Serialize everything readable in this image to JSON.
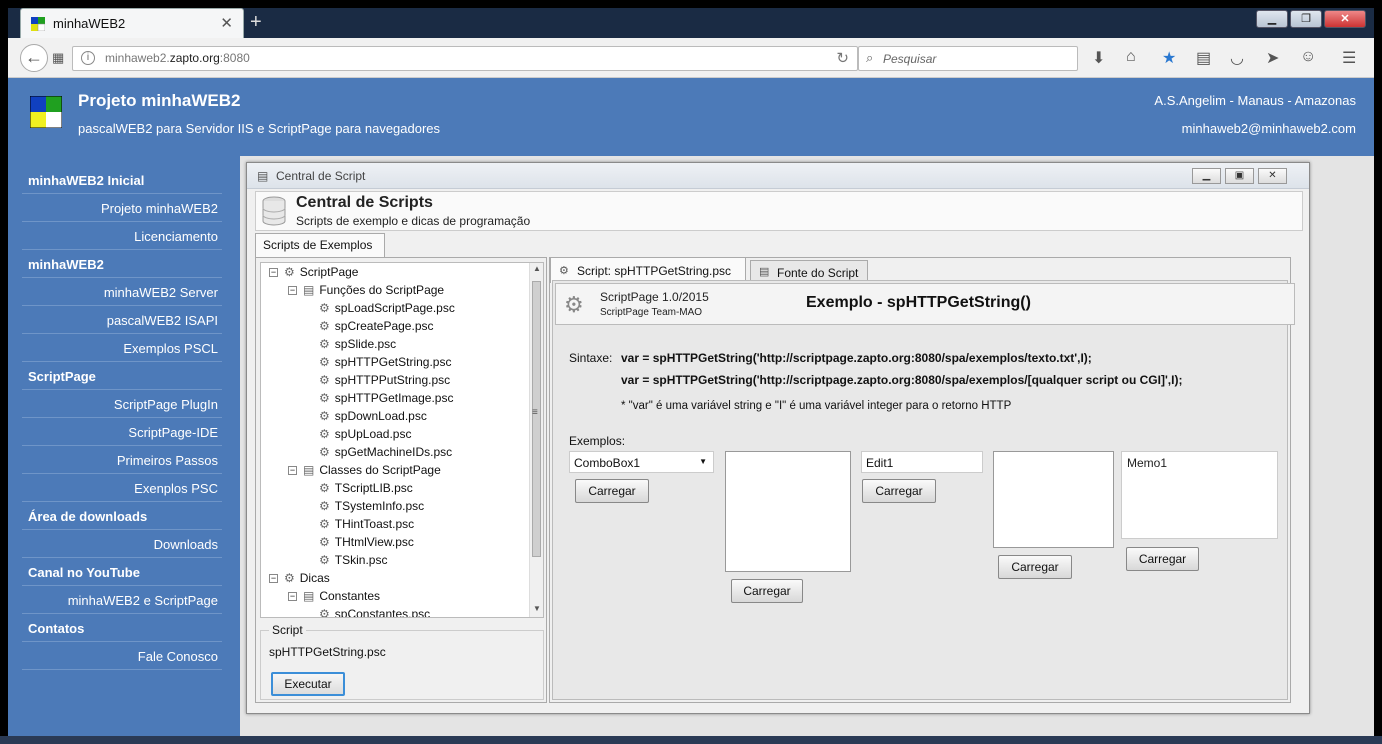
{
  "browser": {
    "tab_title": "minhaWEB2",
    "url_prefix": "minhaweb2.",
    "url_domain": "zapto.org",
    "url_port": ":8080",
    "search_placeholder": "Pesquisar"
  },
  "header": {
    "title": "Projeto minhaWEB2",
    "subtitle": "pascalWEB2 para Servidor IIS e ScriptPage para navegadores",
    "author": "A.S.Angelim - Manaus - Amazonas",
    "email": "minhaweb2@minhaweb2.com"
  },
  "sidebar": {
    "items": [
      {
        "type": "cat",
        "label": "minhaWEB2 Inicial"
      },
      {
        "type": "it",
        "label": "Projeto minhaWEB2"
      },
      {
        "type": "it",
        "label": "Licenciamento"
      },
      {
        "type": "cat",
        "label": "minhaWEB2"
      },
      {
        "type": "it",
        "label": "minhaWEB2 Server"
      },
      {
        "type": "it",
        "label": "pascalWEB2 ISAPI"
      },
      {
        "type": "it",
        "label": "Exemplos PSCL"
      },
      {
        "type": "cat",
        "label": "ScriptPage"
      },
      {
        "type": "it",
        "label": "ScriptPage PlugIn"
      },
      {
        "type": "it",
        "label": "ScriptPage-IDE"
      },
      {
        "type": "it",
        "label": "Primeiros Passos"
      },
      {
        "type": "it",
        "label": "Exenplos PSC"
      },
      {
        "type": "cat",
        "label": "Área de downloads"
      },
      {
        "type": "it",
        "label": "Downloads"
      },
      {
        "type": "cat",
        "label": "Canal no YouTube"
      },
      {
        "type": "it",
        "label": "minhaWEB2 e ScriptPage"
      },
      {
        "type": "cat",
        "label": "Contatos"
      },
      {
        "type": "it",
        "label": "Fale Conosco"
      }
    ]
  },
  "window": {
    "title": "Central de Script",
    "heading": "Central de Scripts",
    "subheading": "Scripts de exemplo e dicas de programação",
    "left_tab": "Scripts de Exemplos"
  },
  "tree": [
    {
      "depth": 0,
      "pm": "−",
      "label": "ScriptPage"
    },
    {
      "depth": 1,
      "pm": "−",
      "label": "Funções do ScriptPage"
    },
    {
      "depth": 2,
      "pm": "",
      "label": "spLoadScriptPage.psc"
    },
    {
      "depth": 2,
      "pm": "",
      "label": "spCreatePage.psc"
    },
    {
      "depth": 2,
      "pm": "",
      "label": "spSlide.psc"
    },
    {
      "depth": 2,
      "pm": "",
      "label": "spHTTPGetString.psc"
    },
    {
      "depth": 2,
      "pm": "",
      "label": "spHTTPPutString.psc"
    },
    {
      "depth": 2,
      "pm": "",
      "label": "spHTTPGetImage.psc"
    },
    {
      "depth": 2,
      "pm": "",
      "label": "spDownLoad.psc"
    },
    {
      "depth": 2,
      "pm": "",
      "label": "spUpLoad.psc"
    },
    {
      "depth": 2,
      "pm": "",
      "label": "spGetMachineIDs.psc"
    },
    {
      "depth": 1,
      "pm": "−",
      "label": "Classes do ScriptPage"
    },
    {
      "depth": 2,
      "pm": "",
      "label": "TScriptLIB.psc"
    },
    {
      "depth": 2,
      "pm": "",
      "label": "TSystemInfo.psc"
    },
    {
      "depth": 2,
      "pm": "",
      "label": "THintToast.psc"
    },
    {
      "depth": 2,
      "pm": "",
      "label": "THtmlView.psc"
    },
    {
      "depth": 2,
      "pm": "",
      "label": "TSkin.psc"
    },
    {
      "depth": 0,
      "pm": "−",
      "label": "Dicas"
    },
    {
      "depth": 1,
      "pm": "−",
      "label": "Constantes"
    },
    {
      "depth": 2,
      "pm": "",
      "label": "spConstantes.psc"
    }
  ],
  "script_group": {
    "legend": "Script",
    "value": "spHTTPGetString.psc",
    "execute_label": "Executar"
  },
  "right": {
    "tab_script": "Script: spHTTPGetString.psc",
    "tab_source": "Fonte do Script",
    "version": "ScriptPage 1.0/2015",
    "team": "ScriptPage Team-MAO",
    "example_title": "Exemplo - spHTTPGetString()",
    "syntax_label": "Sintaxe:",
    "syntax_line1": "var = spHTTPGetString('http://scriptpage.zapto.org:8080/spa/exemplos/texto.txt',I);",
    "syntax_line2": "var = spHTTPGetString('http://scriptpage.zapto.org:8080/spa/exemplos/[qualquer script ou CGI]',I);",
    "note": "* \"var\" é uma variável string e \"I\" é uma variável integer para o retorno HTTP",
    "examples_label": "Exemplos:",
    "combobox_value": "ComboBox1",
    "edit_value": "Edit1",
    "memo_value": "Memo1",
    "load_label": "Carregar"
  }
}
